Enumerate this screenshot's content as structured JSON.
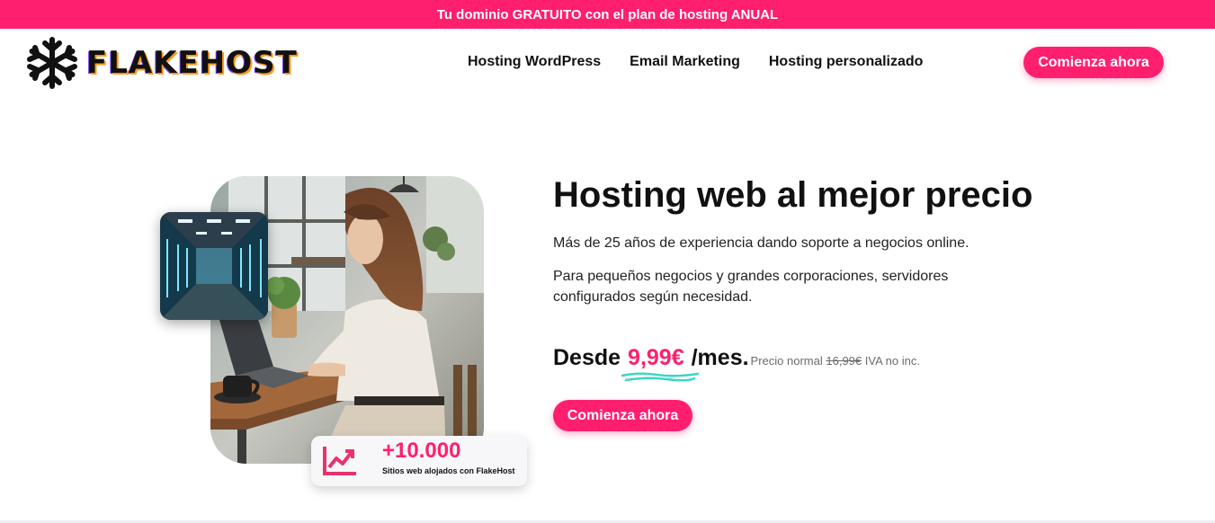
{
  "promo": {
    "text": "Tu dominio GRATUITO con el plan de hosting ANUAL"
  },
  "header": {
    "logo_text": "FLAKEHOST",
    "nav": [
      {
        "label": "Hosting WordPress"
      },
      {
        "label": "Email Marketing"
      },
      {
        "label": "Hosting personalizado"
      }
    ],
    "cta_label": "Comienza ahora"
  },
  "hero": {
    "title": "Hosting web al mejor precio",
    "paragraph1": "Más de 25 años de experiencia dando soporte a negocios online.",
    "paragraph2": "Para pequeños negocios y grandes corporaciones, servidores configurados según necesidad.",
    "price": {
      "prefix": "Desde",
      "value": "9,99€",
      "suffix": "/mes.",
      "note_prefix": "Precio normal",
      "old_price": "16,99€",
      "note_suffix": "IVA no inc."
    },
    "cta_label": "Comienza ahora"
  },
  "stats": {
    "number": "+10.000",
    "label": "Sitios web alojados con FlakeHost"
  },
  "colors": {
    "accent": "#ff1f6e",
    "squiggle": "#3ed6c4",
    "text": "#111111"
  },
  "icons": {
    "logo": "snowflake-icon",
    "stats": "trending-up-icon"
  }
}
